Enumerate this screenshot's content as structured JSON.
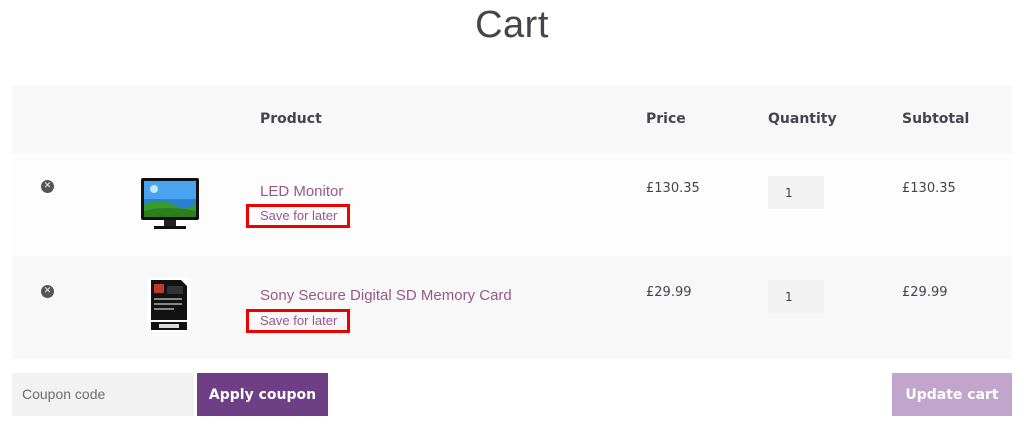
{
  "page": {
    "title": "Cart"
  },
  "table": {
    "headers": {
      "product": "Product",
      "price": "Price",
      "quantity": "Quantity",
      "subtotal": "Subtotal"
    },
    "items": [
      {
        "name": "LED Monitor",
        "save_label": "Save for later",
        "price": "£130.35",
        "quantity": "1",
        "subtotal": "£130.35",
        "remove_glyph": "✕"
      },
      {
        "name": "Sony Secure Digital SD Memory Card",
        "save_label": "Save for later",
        "price": "£29.99",
        "quantity": "1",
        "subtotal": "£29.99",
        "remove_glyph": "✕"
      }
    ]
  },
  "actions": {
    "coupon_placeholder": "Coupon code",
    "apply_label": "Apply coupon",
    "update_label": "Update cart"
  },
  "colors": {
    "link": "#96588a",
    "primary_button": "#6e3f85",
    "disabled_button": "#c1a5cc",
    "highlight_box": "#ee0000"
  }
}
